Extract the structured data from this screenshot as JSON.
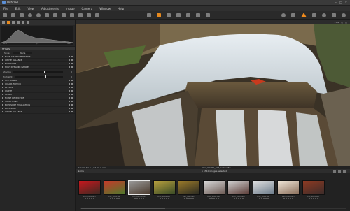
{
  "window": {
    "title": "Untitled",
    "controls": [
      "–",
      "□",
      "×"
    ]
  },
  "menu": [
    "File",
    "Edit",
    "View",
    "Adjustments",
    "Image",
    "Camera",
    "Window",
    "Help"
  ],
  "toolbar": {
    "left_icons": [
      "folder-icon",
      "import-icon",
      "grid-icon",
      "undo-icon",
      "redo-icon",
      "rotate-left-icon",
      "rotate-right-icon",
      "copy-icon",
      "paste-icon",
      "reset-icon",
      "export-icon",
      "settings-icon"
    ],
    "center_icons": [
      "pan-icon",
      "crop-icon",
      "straighten-icon",
      "keystone-icon",
      "spot-icon",
      "picker-icon",
      "brush-icon"
    ],
    "right_icons": [
      "search-icon",
      "loupe-icon",
      "warning-icon",
      "camera-icon",
      "print-icon",
      "export-out-icon",
      "info-icon"
    ]
  },
  "histogram": {
    "left_label": "0.0",
    "mid_label": "1/2",
    "right_label": "255"
  },
  "panel": {
    "styles_header": "STYLES",
    "style_label": "Style",
    "style_value": "None",
    "tools": [
      "BASE CHARACTERISTICS",
      "WHITE BALANCE",
      "EXPOSURE",
      "HIGH DYNAMIC RANGE"
    ],
    "sliders": [
      {
        "label": "Shadow",
        "value": "0",
        "level": 0.62
      },
      {
        "label": "Highlight",
        "value": "0",
        "level": 0.62
      }
    ],
    "tools2": [
      "HISTOGRAM",
      "COLOR EDITOR",
      "LEVELS",
      "CURVE",
      "CLARITY",
      "NOISE REDUCTION",
      "VIGNETTING",
      "EXPOSURE EVALUATION",
      "EXPOSURE",
      "WHITE BALANCE"
    ]
  },
  "viewer": {
    "zoom": "27%"
  },
  "infobar": {
    "left": "ISO100  f/4.8  1/15  18.0 mm",
    "center": "DSC_WATER_024_1234.NEF"
  },
  "browser": {
    "tab": "Name",
    "count": "1 of 10 images selected",
    "thumbs": [
      {
        "label": "DSC_0001.NEF",
        "c1": "#c8171e",
        "c2": "#3b2a22"
      },
      {
        "label": "DSC_0002.NEF",
        "c1": "#c73a2a",
        "c2": "#4d7a2c"
      },
      {
        "label": "DSC_WATER.NEF",
        "c1": "#9a9a9a",
        "c2": "#4a3a2d"
      },
      {
        "label": "DSC_0004.NEF",
        "c1": "#b8a03e",
        "c2": "#384a26"
      },
      {
        "label": "DSC_0005.NEF",
        "c1": "#9b7b2a",
        "c2": "#2a2a22"
      },
      {
        "label": "DSC_0006.NEF",
        "c1": "#d8d8d8",
        "c2": "#6d5b55"
      },
      {
        "label": "DSC_0007.NEF",
        "c1": "#d0d0d0",
        "c2": "#5a3b36"
      },
      {
        "label": "DSC_0008.NEF",
        "c1": "#e0e0e0",
        "c2": "#6b7b8a"
      },
      {
        "label": "DSC_0009.NEF",
        "c1": "#f0e6d8",
        "c2": "#8a6e5a"
      },
      {
        "label": "DSC_0010.NEF",
        "c1": "#8f3a22",
        "c2": "#3c2c2a"
      }
    ]
  },
  "colors": {
    "accent": "#e6891e",
    "panel": "#262626",
    "header": "#333333"
  }
}
